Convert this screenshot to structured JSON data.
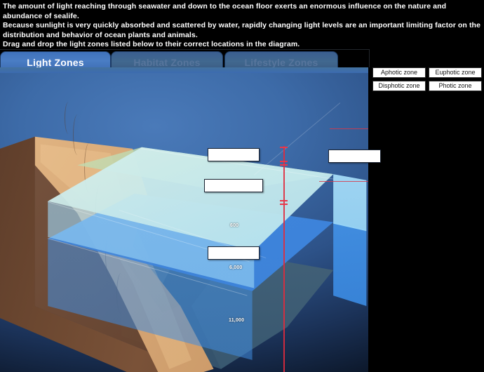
{
  "intro": {
    "line1": "The amount of light reaching through seawater and down to the ocean floor exerts an enormous influence on the nature and abundance of sealife.",
    "line2": "Because sunlight is very quickly absorbed and scattered by water, rapidly changing light levels are an important limiting factor on the distribution and behavior of ocean plants and animals.",
    "line3": "Drag and drop the light zones listed below to their correct locations in the diagram."
  },
  "tabs": [
    {
      "label": "Light Zones",
      "active": true
    },
    {
      "label": "Habitat Zones",
      "active": false
    },
    {
      "label": "Lifestyle Zones",
      "active": false
    }
  ],
  "chips": [
    {
      "label": "Aphotic zone"
    },
    {
      "label": "Euphotic zone"
    },
    {
      "label": "Disphotic zone"
    },
    {
      "label": "Photic zone"
    }
  ],
  "drop_targets": [
    {
      "id": "drop-upper-left",
      "value": ""
    },
    {
      "id": "drop-middle-left",
      "value": ""
    },
    {
      "id": "drop-lower-left",
      "value": ""
    },
    {
      "id": "drop-right",
      "value": ""
    }
  ],
  "depth_labels": [
    {
      "text": "600"
    },
    {
      "text": "6,000"
    },
    {
      "text": "11,000"
    }
  ],
  "colors": {
    "tab_active": "#4a7dc4",
    "tab_inactive": "#3a5e90",
    "background": "#3d6ba8",
    "surface_water": "#cdeceb",
    "mid_water": "#3f86dd",
    "deep_water": "#46657c",
    "sand": "#d9ad7b",
    "cliff": "#6a4630",
    "scale_red": "#e02b3d",
    "dropbox_fill": "#ffffff"
  }
}
